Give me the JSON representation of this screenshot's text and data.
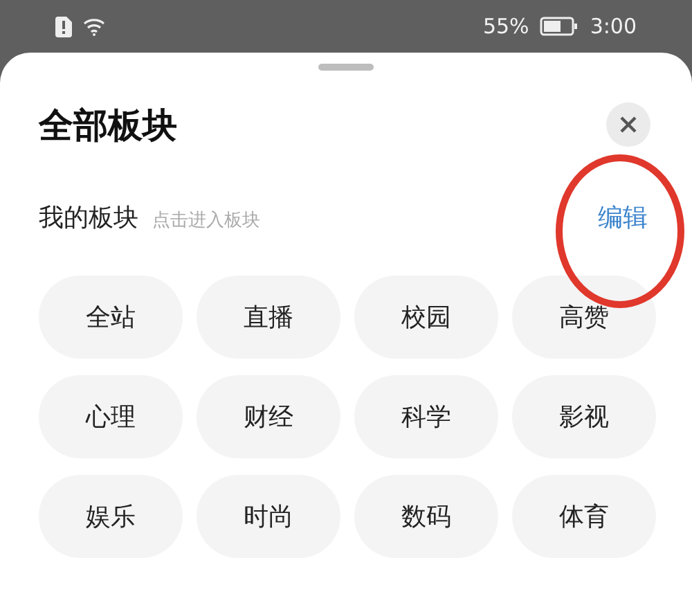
{
  "status_bar": {
    "battery": "55%",
    "time": "3:00"
  },
  "sheet": {
    "title": "全部板块",
    "section": {
      "title": "我的板块",
      "hint": "点击进入板块",
      "action": "编辑"
    },
    "chips": [
      {
        "label": "全站"
      },
      {
        "label": "直播"
      },
      {
        "label": "校园"
      },
      {
        "label": "高赞"
      },
      {
        "label": "心理"
      },
      {
        "label": "财经"
      },
      {
        "label": "科学"
      },
      {
        "label": "影视"
      },
      {
        "label": "娱乐"
      },
      {
        "label": "时尚"
      },
      {
        "label": "数码"
      },
      {
        "label": "体育"
      }
    ]
  }
}
